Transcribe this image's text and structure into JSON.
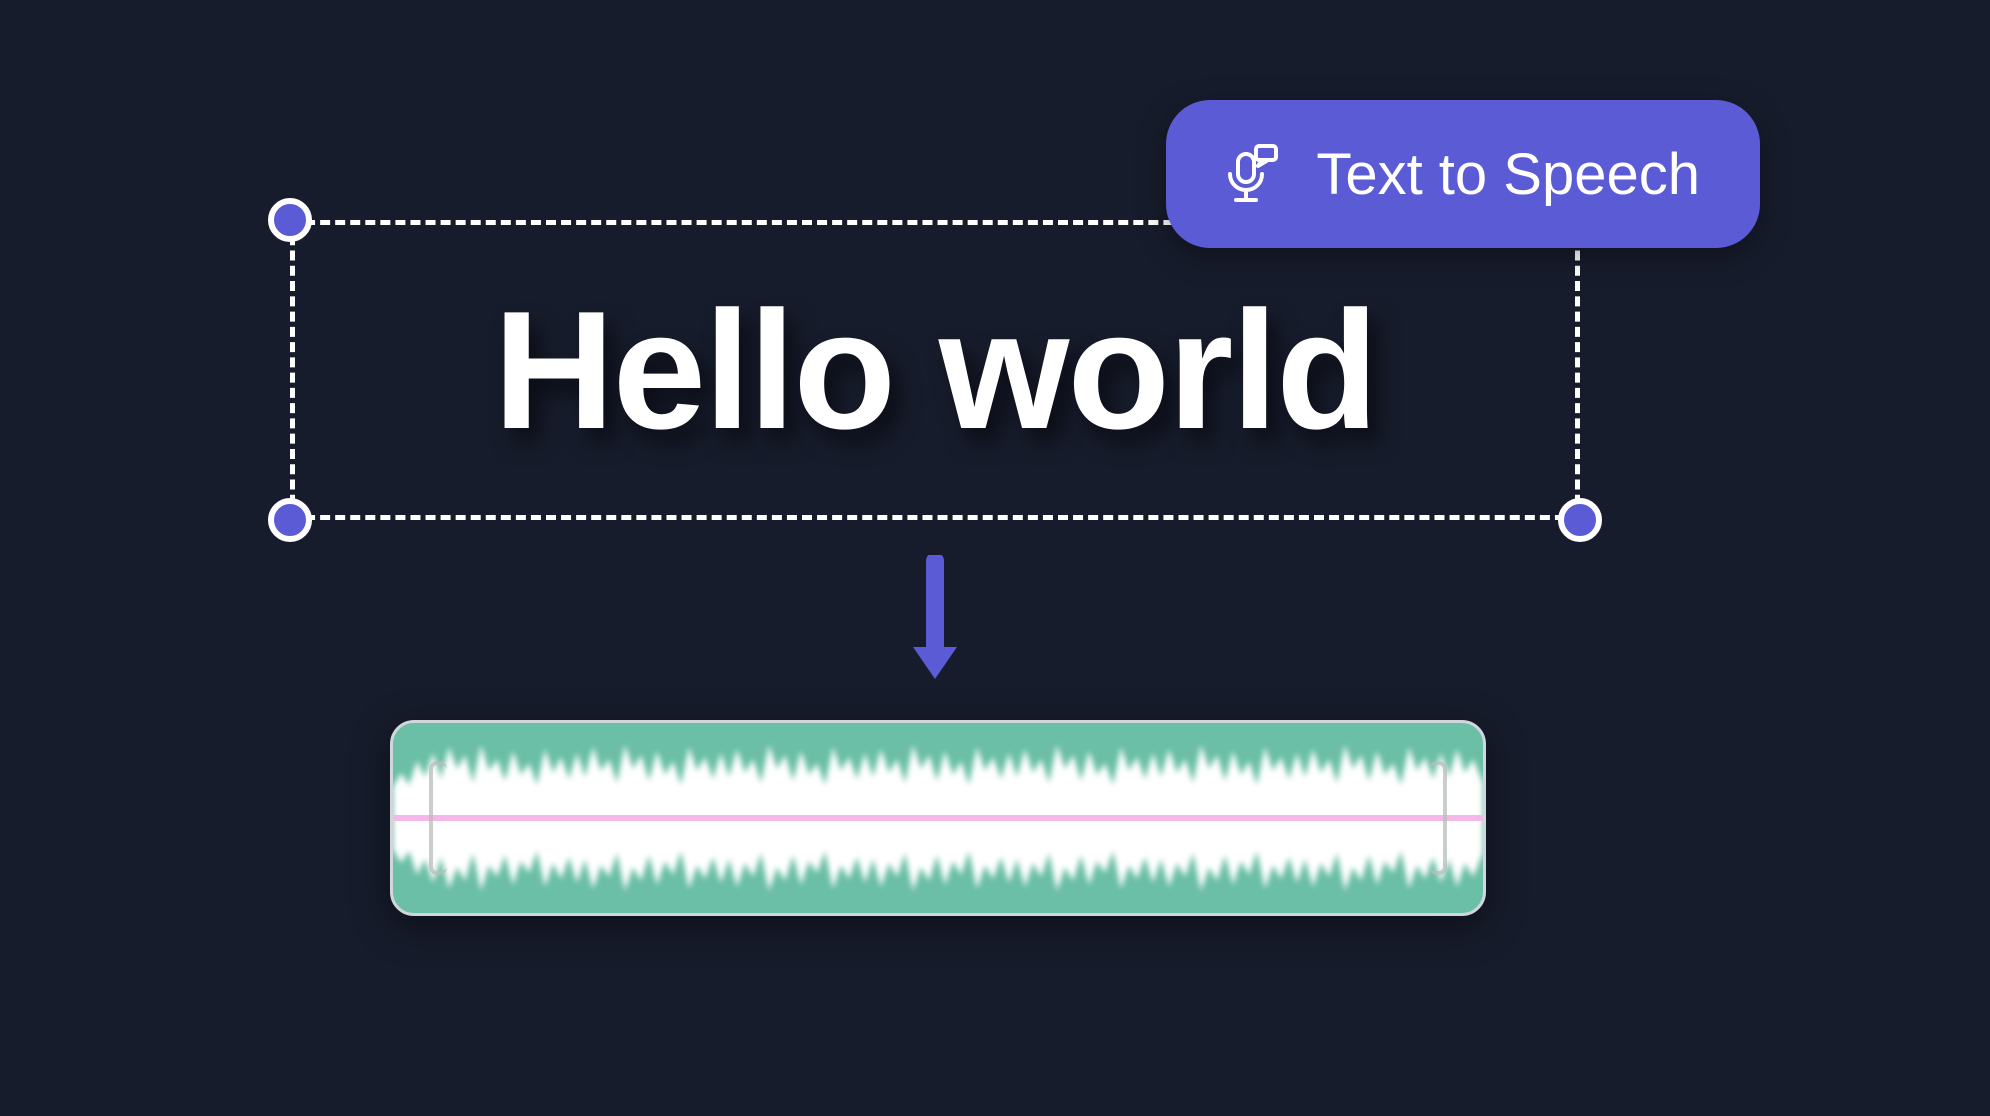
{
  "selection": {
    "text": "Hello world"
  },
  "action_button": {
    "label": "Text to Speech",
    "icon": "microphone-chat-icon"
  },
  "flow": {
    "arrow_icon": "arrow-down-icon"
  },
  "waveform": {
    "label": "audio-waveform-clip"
  },
  "colors": {
    "background": "#171c2c",
    "accent": "#5b5bd6",
    "waveform_bg": "#6bbfa6",
    "waveform_midline": "#f3b8e7"
  }
}
